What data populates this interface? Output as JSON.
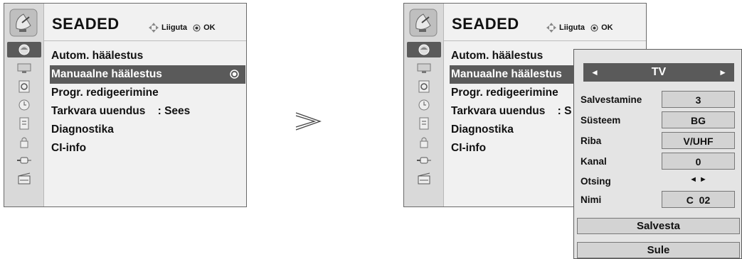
{
  "menu": {
    "title": "SEADED",
    "hint_move": "Liiguta",
    "hint_ok": "OK",
    "items": [
      {
        "label": "Autom. häälestus"
      },
      {
        "label": "Manuaalne häälestus"
      },
      {
        "label": "Progr. redigeerimine"
      },
      {
        "label": "Tarkvara uuendus    : Sees"
      },
      {
        "label": "Diagnostika"
      },
      {
        "label": "CI-info"
      }
    ],
    "items_right": [
      {
        "label": "Autom. häälestus"
      },
      {
        "label": "Manuaalne häälestus"
      },
      {
        "label": "Progr. redigeerimine"
      },
      {
        "label": "Tarkvara uuendus    : S"
      },
      {
        "label": "Diagnostika"
      },
      {
        "label": "CI-info"
      }
    ],
    "selected_index": 1,
    "sidebar_icons": [
      "picture-icon",
      "monitor-icon",
      "speaker-icon",
      "clock-icon",
      "option-icon",
      "lock-icon",
      "input-icon",
      "media-icon"
    ]
  },
  "popup": {
    "source": "TV",
    "rows": [
      {
        "label": "Salvestamine",
        "value": "3"
      },
      {
        "label": "Süsteem",
        "value": "BG"
      },
      {
        "label": "Riba",
        "value": "V/UHF"
      },
      {
        "label": "Kanal",
        "value": "0"
      },
      {
        "label": "Otsing",
        "value": ""
      },
      {
        "label": "Nimi",
        "value": "C  02"
      }
    ],
    "search_arrows": "◄ ►",
    "save_label": "Salvesta",
    "close_label": "Sule"
  },
  "colors": {
    "selection": "#5a5a5a",
    "panel": "#f1f1f1",
    "sidebar": "#d9d9d9",
    "popup": "#e4e4e4",
    "field": "#d3d3d3"
  }
}
